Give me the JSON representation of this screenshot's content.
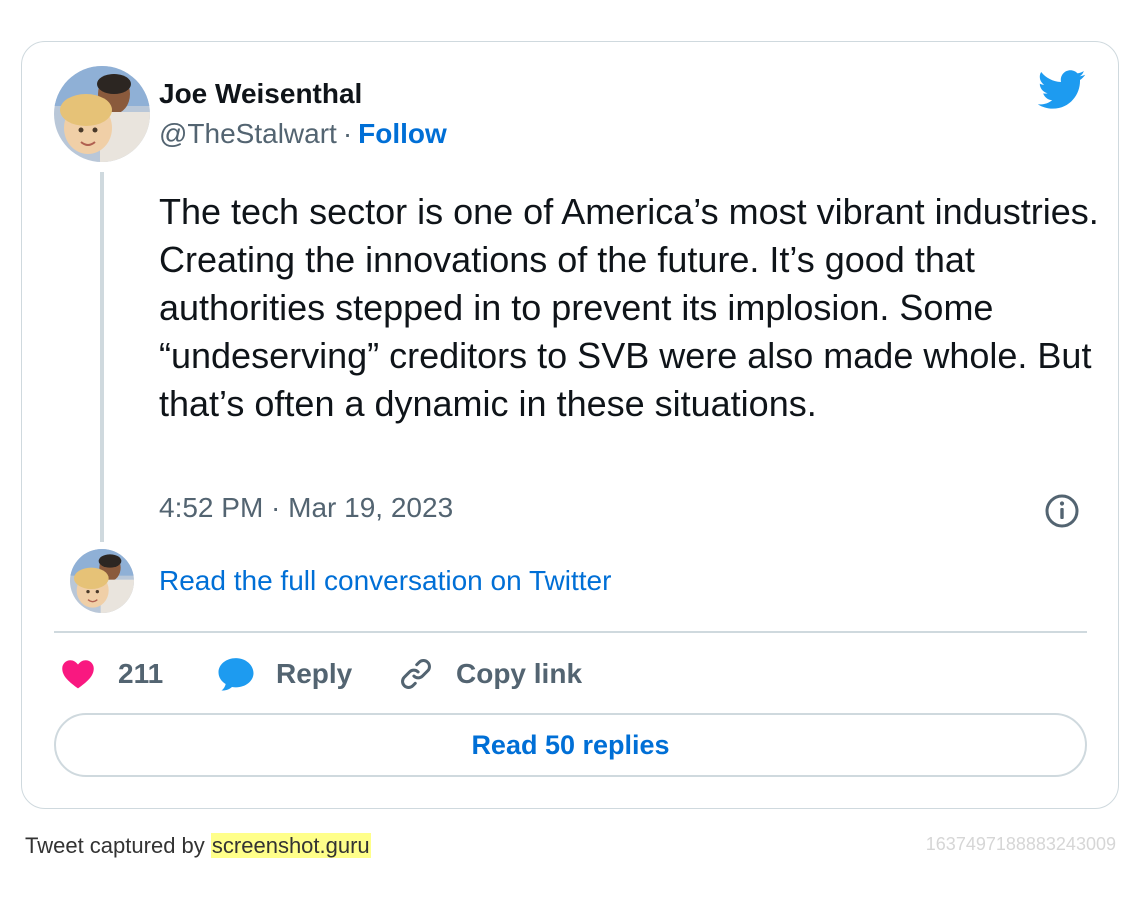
{
  "tweet": {
    "author_name": "Joe Weisenthal",
    "handle": "@TheStalwart",
    "separator": "·",
    "follow_label": "Follow",
    "text": "The tech sector is one of America’s most vibrant industries. Creating the innovations of the future. It’s good that authorities stepped in to prevent its implosion. Some “undeserving” creditors to SVB were also made whole. But that’s often a dynamic in these situations.",
    "timestamp": "4:52 PM · Mar 19, 2023",
    "read_full_label": "Read the full conversation on Twitter",
    "like_count": "211",
    "reply_label": "Reply",
    "copy_link_label": "Copy link",
    "read_replies_label": "Read 50 replies"
  },
  "footer": {
    "captured_by_prefix": "Tweet captured by",
    "captured_by_site": "screenshot.guru",
    "tweet_id": "1637497188883243009"
  },
  "icons": {
    "brand": "twitter-bird-icon",
    "info": "info-icon",
    "like": "heart-icon",
    "reply": "speech-bubble-icon",
    "copy": "link-icon"
  },
  "colors": {
    "accent": "#006fd6",
    "twitter_blue": "#1d9bf0",
    "heart": "#f91880",
    "muted_text": "#536471",
    "border": "#cfd9de",
    "highlight": "#ffff8a"
  }
}
